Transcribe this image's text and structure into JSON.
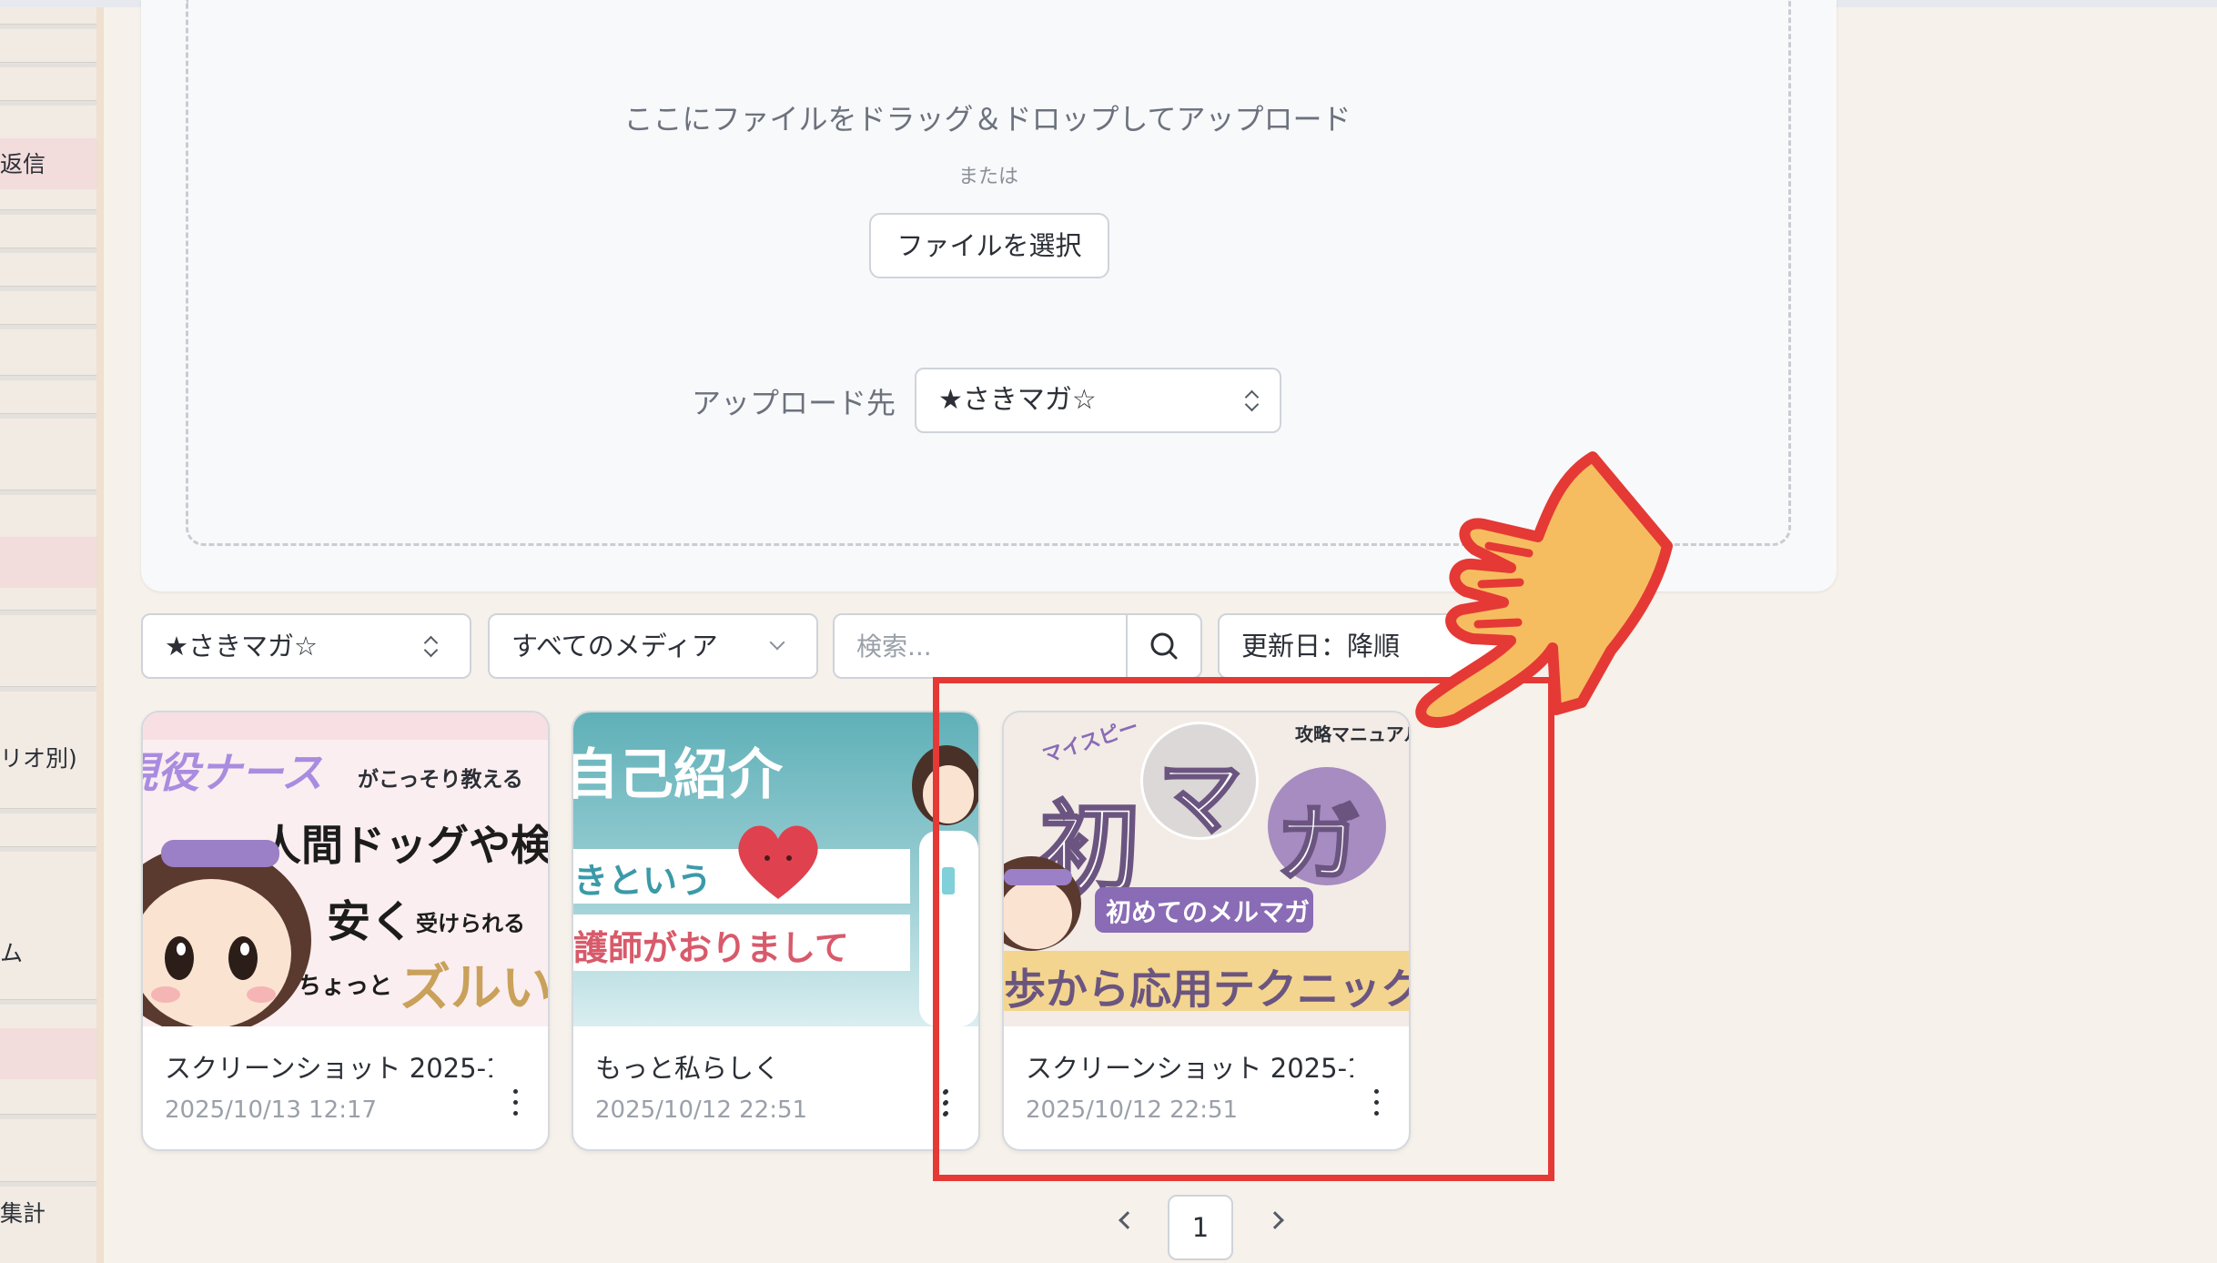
{
  "sidebar": {
    "items": [
      {
        "label": "返信"
      },
      {
        "label": "リオ別)"
      },
      {
        "label": "ム"
      },
      {
        "label": "集計"
      }
    ]
  },
  "upload": {
    "drop_text": "ここにファイルをドラッグ＆ドロップしてアップロード",
    "or_text": "または",
    "select_file_label": "ファイルを選択",
    "destination_label": "アップロード先",
    "destination_value": "★さきマガ☆"
  },
  "filters": {
    "folder": "★さきマガ☆",
    "media_type": "すべてのメディア",
    "search_placeholder": "検索...",
    "sort": "更新日：降順"
  },
  "media": [
    {
      "title": "スクリーンショット 2025-1…",
      "date": "2025/10/13 12:17",
      "thumb_text": [
        "現役ナース",
        "がこっそり教える",
        "人間ドッグや検診",
        "安く",
        "受けられる",
        "ちょっと",
        "ズルい"
      ]
    },
    {
      "title": "もっと私らしく",
      "date": "2025/10/12 22:51",
      "thumb_text": [
        "自己紹介",
        "きという",
        "護師がおりまして"
      ]
    },
    {
      "title": "スクリーンショット 2025-1…",
      "date": "2025/10/12 22:51",
      "thumb_text": [
        "マイスピー",
        "攻略マニュアル",
        "初",
        "マ",
        "ガ",
        "初めてのメルマガ",
        "歩から応用テクニック"
      ]
    }
  ],
  "pagination": {
    "current": "1"
  },
  "colors": {
    "annotation_red": "#e53935",
    "hand_fill": "#f6bd60",
    "background": "#f6f1ea"
  }
}
